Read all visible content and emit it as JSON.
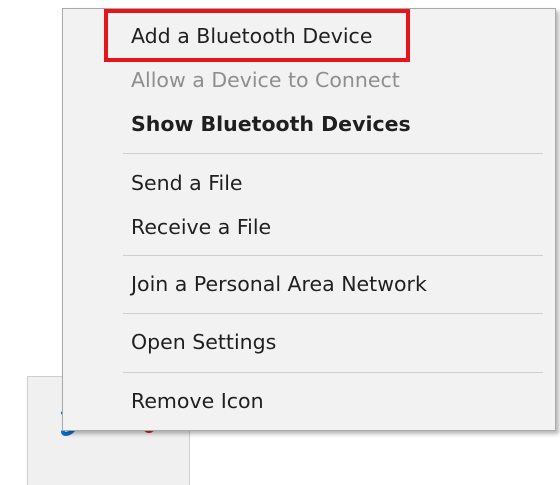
{
  "menu": {
    "items": [
      {
        "id": "add-bluetooth-device",
        "label": "Add a Bluetooth Device",
        "state": "normal"
      },
      {
        "id": "allow-device-connect",
        "label": "Allow a Device to Connect",
        "state": "disabled"
      },
      {
        "id": "show-bluetooth-devices",
        "label": "Show Bluetooth Devices",
        "state": "default-bold"
      },
      {
        "id": "send-file",
        "label": "Send a File",
        "state": "normal"
      },
      {
        "id": "receive-file",
        "label": "Receive a File",
        "state": "normal"
      },
      {
        "id": "join-pan",
        "label": "Join a Personal Area Network",
        "state": "normal"
      },
      {
        "id": "open-settings",
        "label": "Open Settings",
        "state": "normal"
      },
      {
        "id": "remove-icon",
        "label": "Remove Icon",
        "state": "normal"
      }
    ]
  },
  "tray": {
    "icons": [
      "bluetooth-icon",
      "tray-app-icon"
    ]
  },
  "colors": {
    "menu_background": "#f2f2f2",
    "menu_text": "#1f1f1f",
    "disabled_text": "#8e8e8e",
    "highlight_border": "#e8141c",
    "bluetooth_blue": "#0a6fd8"
  }
}
